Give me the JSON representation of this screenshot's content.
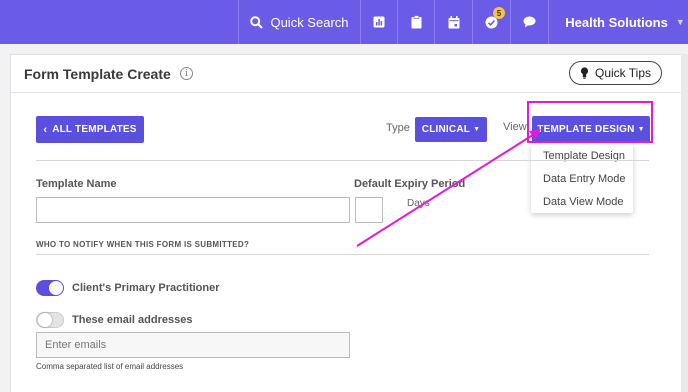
{
  "topbar": {
    "search_label": "Quick Search",
    "badge_count": "5",
    "org_name": "Health Solutions",
    "color": "#6b5ce7",
    "icons": [
      "search-icon",
      "report-icon",
      "clipboard-icon",
      "calendar-icon",
      "checklist-icon",
      "chat-icon",
      "chevron-down-icon"
    ]
  },
  "page": {
    "title": "Form Template Create",
    "info_glyph": "i",
    "quick_tips_label": "Quick Tips"
  },
  "toolbar": {
    "all_templates_label": "ALL TEMPLATES",
    "type_label": "Type",
    "type_value": "CLINICAL",
    "view_label": "View",
    "view_value": "TEMPLATE DESIGN",
    "accent": "#5b4fe0"
  },
  "view_dropdown": {
    "options": [
      "Template Design",
      "Data Entry Mode",
      "Data View Mode"
    ]
  },
  "form": {
    "template_name_label": "Template Name",
    "template_name_value": "",
    "expiry_label": "Default Expiry Period",
    "expiry_value": "",
    "days_label": "Days",
    "notify_heading": "WHO TO NOTIFY WHEN THIS FORM IS SUBMITTED?",
    "primary_practitioner_label": "Client's Primary Practitioner",
    "primary_practitioner_on": true,
    "email_addresses_label": "These email addresses",
    "email_addresses_on": false,
    "email_placeholder": "Enter emails",
    "email_help": "Comma separated list of email addresses"
  },
  "annotation": {
    "color": "#e31bd8"
  }
}
